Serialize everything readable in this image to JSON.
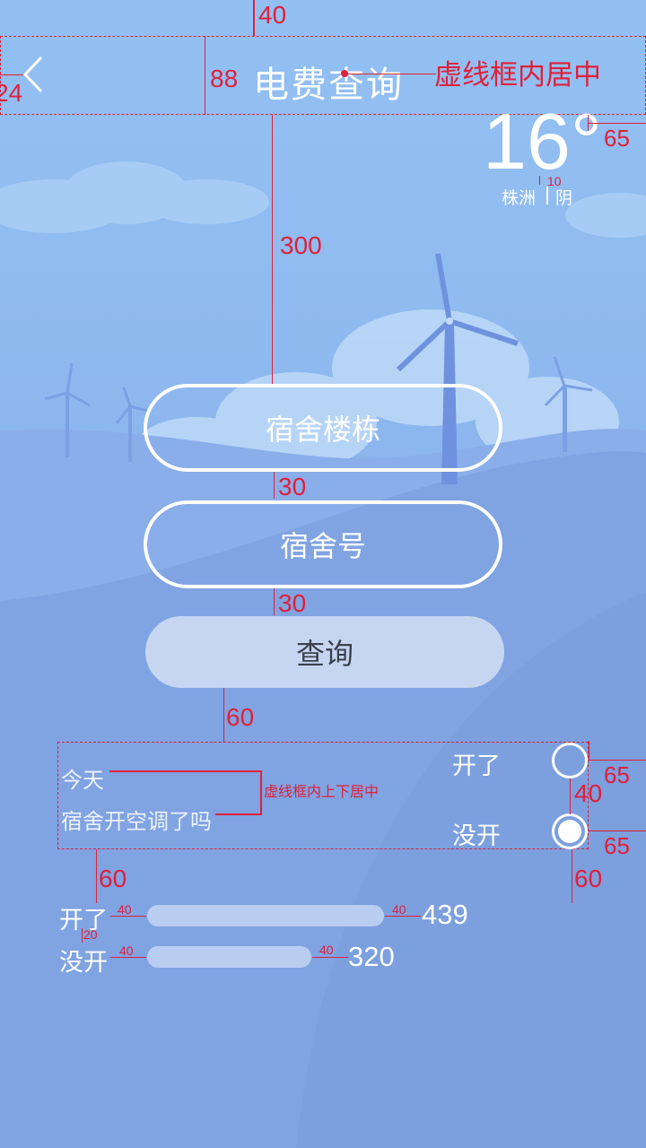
{
  "header": {
    "title": "电费查询",
    "back_icon": "chevron-left-icon"
  },
  "weather": {
    "temperature": "16°",
    "city": "株洲",
    "condition": "阴"
  },
  "form": {
    "building_label": "宿舍楼栋",
    "room_label": "宿舍号",
    "query_label": "查询"
  },
  "poll": {
    "line1": "今天",
    "line2": "宿舍开空调了吗",
    "options": [
      {
        "label": "开了",
        "selected": false
      },
      {
        "label": "没开",
        "selected": true
      }
    ]
  },
  "stats": [
    {
      "label": "开了",
      "value": "439",
      "bar_fraction": 1.0
    },
    {
      "label": "没开",
      "value": "320",
      "bar_fraction": 0.73
    }
  ],
  "annotations": {
    "m_40_top": "40",
    "m_88": "88",
    "m_24": "24",
    "center_note": "虚线框内居中",
    "m_65_temp": "65",
    "m_10": "10",
    "m_300": "300",
    "m_30_a": "30",
    "m_30_b": "30",
    "m_60_a": "60",
    "vcenter_note": "虚线框内上下居中",
    "m_65_r1": "65",
    "m_40_mid": "40",
    "m_65_r2": "65",
    "m_60_left": "60",
    "m_60_right": "60",
    "bar_40_a1": "40",
    "bar_40_a2": "40",
    "bar_20": "20",
    "bar_40_b1": "40",
    "bar_40_b2": "40"
  },
  "colors": {
    "accent": "#e0203a",
    "background_top": "#93c0f2",
    "background_bottom": "#7fa3e0",
    "button_fill": "#c6d6f1"
  }
}
